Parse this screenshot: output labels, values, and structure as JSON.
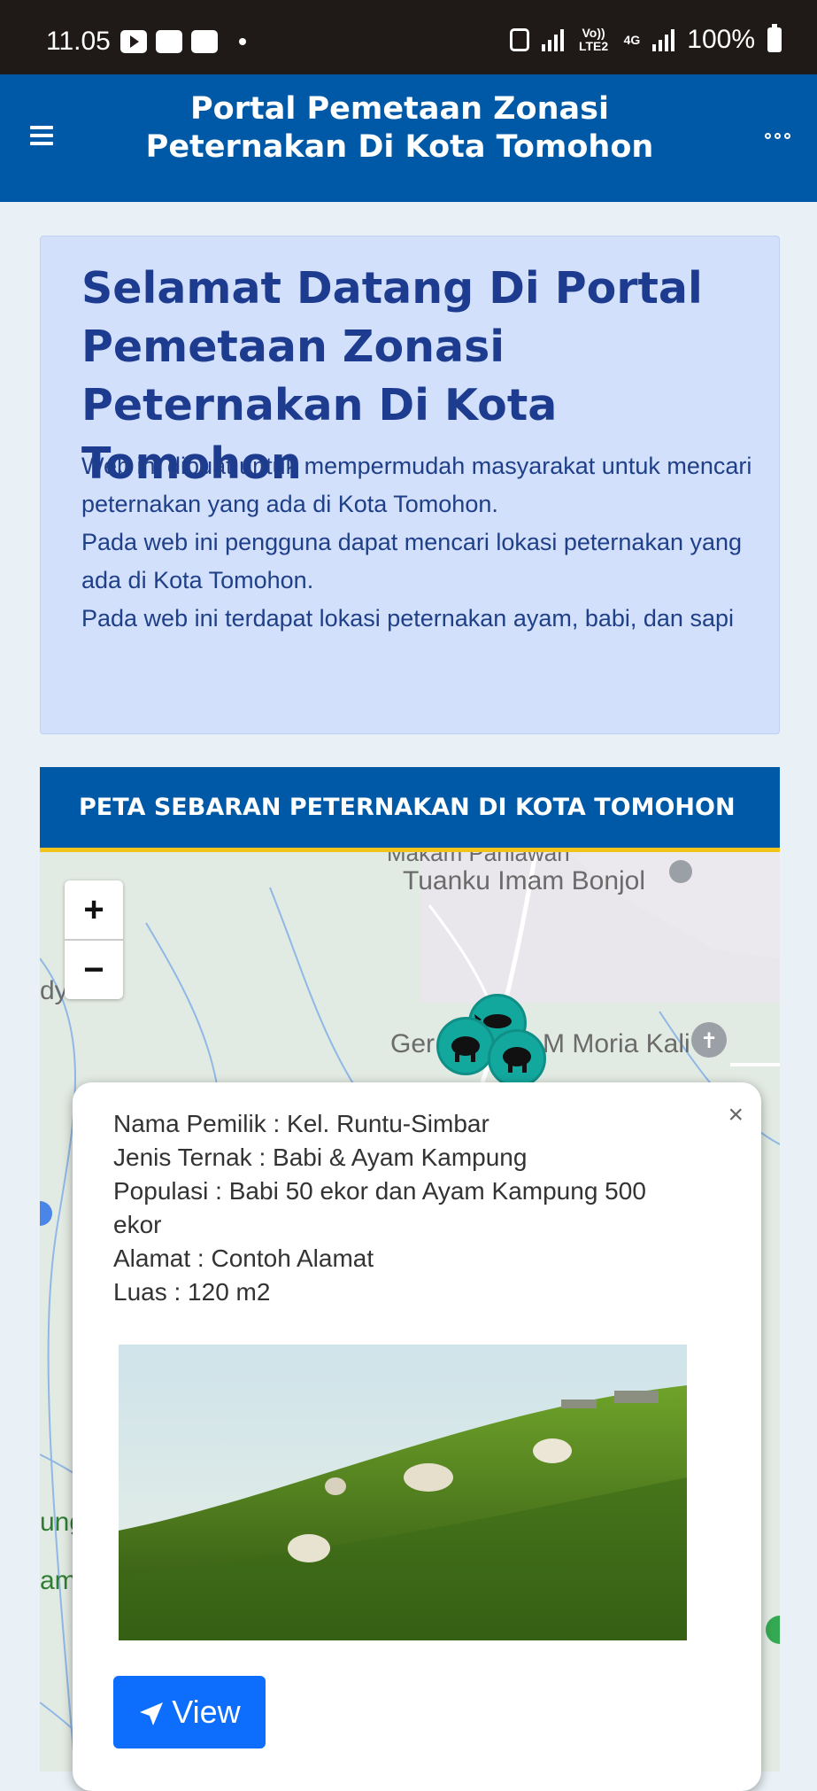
{
  "status_bar": {
    "time": "11.05",
    "network": "4G",
    "lte_label": "Vo)) LTE2",
    "battery": "100%"
  },
  "appbar": {
    "title_line1": "Portal Pemetaan Zonasi",
    "title_line2": "Peternakan Di Kota Tomohon",
    "menu_icon": "hamburger-icon",
    "more_icon": "more-horizontal-icon"
  },
  "welcome": {
    "title": "Selamat Datang Di Portal Pemetaan Zonasi Peternakan Di Kota Tomohon",
    "paragraph1": "Web ini dibuat untuk mempermudah masyarakat untuk mencari peternakan yang ada di Kota Tomohon.",
    "paragraph2": "Pada web ini pengguna dapat mencari lokasi peternakan yang ada di Kota Tomohon.",
    "paragraph3": "Pada web ini terdapat lokasi peternakan ayam, babi, dan sapi"
  },
  "map_section": {
    "title": "PETA SEBARAN PETERNAKAN DI KOTA TOMOHON",
    "zoom_in": "+",
    "zoom_out": "−",
    "labels": {
      "poi_top_cut": "Makam Pahlawan",
      "poi_top": "Tuanku Imam Bonjol",
      "poi_mid_left": "Ger",
      "poi_mid_right": "M Moria Kali",
      "edge_left1": "dy",
      "edge_left2": "ung",
      "edge_left3": "am"
    }
  },
  "popup": {
    "close": "×",
    "owner": "Nama Pemilik : Kel. Runtu-Simbar",
    "type": "Jenis Ternak : Babi & Ayam Kampung",
    "population": "Populasi : Babi 50 ekor dan Ayam Kampung 500 ekor",
    "address": "Alamat : Contoh Alamat",
    "area": "Luas : 120 m2",
    "button_label": "View"
  },
  "colors": {
    "header_blue": "#0059a6",
    "welcome_bg": "#d2e0fb",
    "title_blue": "#1d3b8f",
    "accent_yellow": "#f2c318",
    "cluster_teal": "#13a89e",
    "button_blue": "#0d6efd"
  }
}
